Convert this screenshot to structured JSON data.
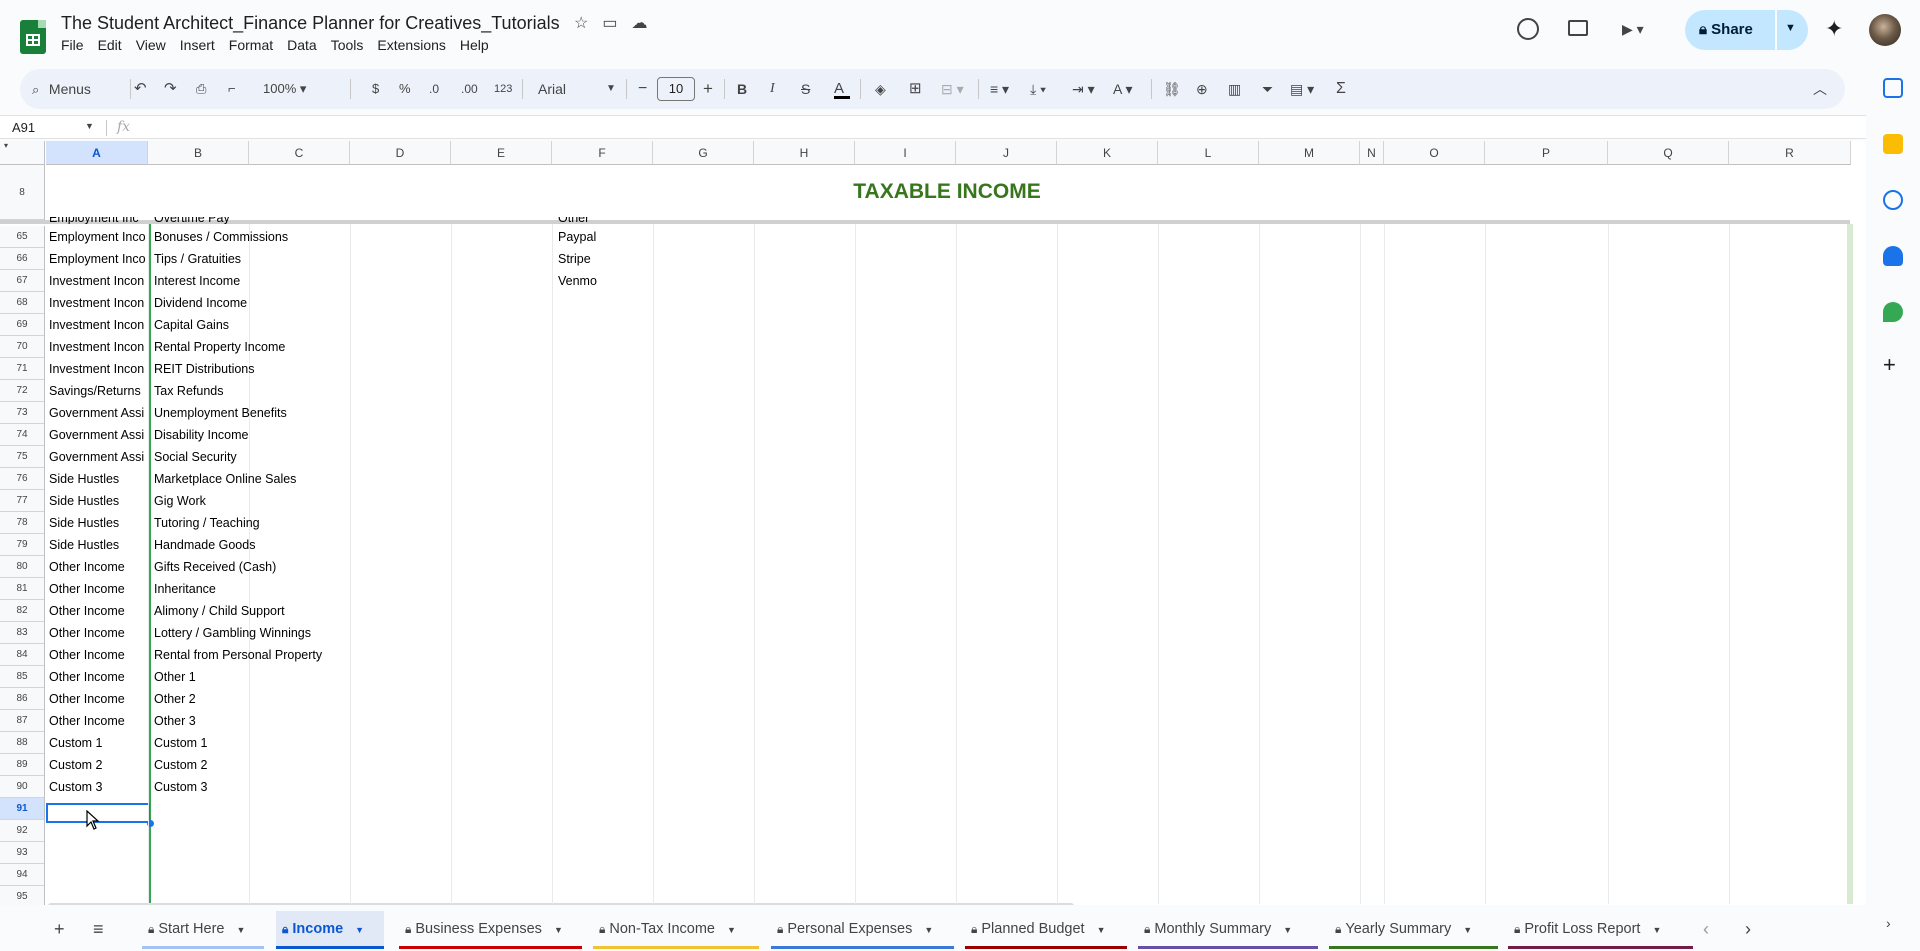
{
  "doc": {
    "title": "The Student Architect_Finance Planner for Creatives_Tutorials",
    "menus": [
      "File",
      "Edit",
      "View",
      "Insert",
      "Format",
      "Data",
      "Tools",
      "Extensions",
      "Help"
    ],
    "share_label": "Share"
  },
  "toolbar": {
    "search_label": "Menus",
    "zoom": "100%",
    "currency": "$",
    "percent": "%",
    "dec_less": ".0",
    "dec_more": ".00",
    "number_format": "123",
    "font": "Arial",
    "font_size": "10",
    "bold": "B",
    "italic": "I",
    "strike": "S",
    "text_color": "A"
  },
  "formula_bar": {
    "name_box": "A91",
    "fx": "fx",
    "value": ""
  },
  "columns": [
    "A",
    "B",
    "C",
    "D",
    "E",
    "F",
    "G",
    "H",
    "I",
    "J",
    "K",
    "L",
    "M",
    "N",
    "O",
    "P",
    "Q",
    "R"
  ],
  "frozen": {
    "row_number": "8",
    "title": "TAXABLE INCOME"
  },
  "partial_row": {
    "a": "Employment Inc",
    "b": "Overtime Pay",
    "f": "Other"
  },
  "rows": [
    {
      "n": "65",
      "a": "Employment Inco",
      "b": "Bonuses / Commissions",
      "f": "Paypal"
    },
    {
      "n": "66",
      "a": "Employment Inco",
      "b": "Tips / Gratuities",
      "f": "Stripe"
    },
    {
      "n": "67",
      "a": "Investment Incon",
      "b": "Interest Income",
      "f": "Venmo"
    },
    {
      "n": "68",
      "a": "Investment Incon",
      "b": "Dividend Income",
      "f": ""
    },
    {
      "n": "69",
      "a": "Investment Incon",
      "b": "Capital Gains",
      "f": ""
    },
    {
      "n": "70",
      "a": "Investment Incon",
      "b": "Rental Property Income",
      "f": ""
    },
    {
      "n": "71",
      "a": "Investment Incon",
      "b": "REIT Distributions",
      "f": ""
    },
    {
      "n": "72",
      "a": "Savings/Returns",
      "b": "Tax Refunds",
      "f": ""
    },
    {
      "n": "73",
      "a": "Government Assi",
      "b": "Unemployment Benefits",
      "f": ""
    },
    {
      "n": "74",
      "a": "Government Assi",
      "b": "Disability Income",
      "f": ""
    },
    {
      "n": "75",
      "a": "Government Assi",
      "b": "Social Security",
      "f": ""
    },
    {
      "n": "76",
      "a": "Side Hustles",
      "b": "Marketplace Online Sales",
      "f": ""
    },
    {
      "n": "77",
      "a": "Side Hustles",
      "b": "Gig Work",
      "f": ""
    },
    {
      "n": "78",
      "a": "Side Hustles",
      "b": "Tutoring / Teaching",
      "f": ""
    },
    {
      "n": "79",
      "a": "Side Hustles",
      "b": "Handmade Goods",
      "f": ""
    },
    {
      "n": "80",
      "a": "Other Income",
      "b": "Gifts Received (Cash)",
      "f": ""
    },
    {
      "n": "81",
      "a": "Other Income",
      "b": "Inheritance",
      "f": ""
    },
    {
      "n": "82",
      "a": "Other Income",
      "b": "Alimony / Child Support",
      "f": ""
    },
    {
      "n": "83",
      "a": "Other Income",
      "b": "Lottery / Gambling Winnings",
      "f": ""
    },
    {
      "n": "84",
      "a": "Other Income",
      "b": "Rental from Personal Property",
      "f": ""
    },
    {
      "n": "85",
      "a": "Other Income",
      "b": "Other 1",
      "f": ""
    },
    {
      "n": "86",
      "a": "Other Income",
      "b": "Other 2",
      "f": ""
    },
    {
      "n": "87",
      "a": "Other Income",
      "b": "Other 3",
      "f": ""
    },
    {
      "n": "88",
      "a": "Custom 1",
      "b": "Custom 1",
      "f": ""
    },
    {
      "n": "89",
      "a": "Custom 2",
      "b": "Custom 2",
      "f": ""
    },
    {
      "n": "90",
      "a": "Custom 3",
      "b": "Custom 3",
      "f": ""
    },
    {
      "n": "91",
      "a": "",
      "b": "",
      "f": ""
    },
    {
      "n": "92",
      "a": "",
      "b": "",
      "f": ""
    },
    {
      "n": "93",
      "a": "",
      "b": "",
      "f": ""
    },
    {
      "n": "94",
      "a": "",
      "b": "",
      "f": ""
    },
    {
      "n": "95",
      "a": "",
      "b": "",
      "f": ""
    }
  ],
  "selected_row": "91",
  "tabs": [
    {
      "label": "Start Here",
      "color": "#a4c2f4",
      "active": false
    },
    {
      "label": "Income",
      "color": "#0b57d0",
      "active": true
    },
    {
      "label": "Business Expenses",
      "color": "#cc0000",
      "active": false
    },
    {
      "label": "Non-Tax Income",
      "color": "#f1c232",
      "active": false
    },
    {
      "label": "Personal Expenses",
      "color": "#3c78d8",
      "active": false
    },
    {
      "label": "Planned Budget",
      "color": "#990000",
      "active": false
    },
    {
      "label": "Monthly Summary",
      "color": "#674ea7",
      "active": false
    },
    {
      "label": "Yearly Summary",
      "color": "#38761d",
      "active": false
    },
    {
      "label": "Profit Loss Report",
      "color": "#741b47",
      "active": false
    }
  ],
  "colors": {
    "accent": "#0b57d0",
    "title_green": "#38761d",
    "share_bg": "#c2e7ff"
  }
}
